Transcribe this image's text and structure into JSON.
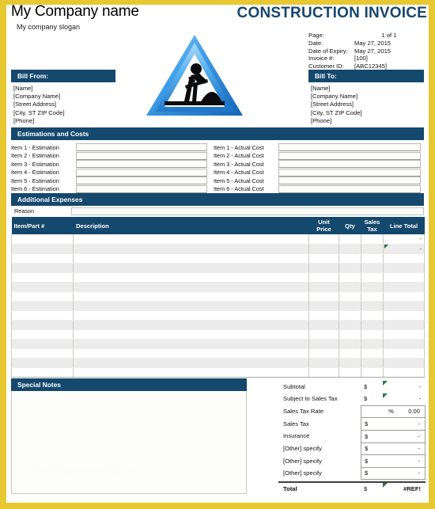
{
  "company": {
    "name": "My Company name",
    "slogan": "My company slogan"
  },
  "document": {
    "title": "CONSTRUCTION INVOICE",
    "logo_icon": "construction-men-at-work-sign-icon"
  },
  "meta": {
    "rows": [
      {
        "label": "Page:",
        "value": "1 of  1"
      },
      {
        "label": "Date:",
        "value": "May 27, 2015"
      },
      {
        "label": "Date of Expiry:",
        "value": "May 27, 2015"
      },
      {
        "label": "Invoice #:",
        "value": "[100]"
      },
      {
        "label": "Customer ID:",
        "value": "[ABC12345]"
      }
    ]
  },
  "bill_from": {
    "title": "Bill From:",
    "lines": [
      "[Name]",
      "[Company Name]",
      "[Street Address]",
      "[City, ST  ZIP Code]",
      "[Phone]"
    ]
  },
  "bill_to": {
    "title": "Bill To:",
    "lines": [
      "[Name]",
      "[Company Name]",
      "[Street Address]",
      "[City, ST  ZIP Code]",
      "[Phone]"
    ]
  },
  "estimations": {
    "title": "Estimations and Costs",
    "left_labels": [
      "Item 1 - Estimation",
      "Item 2 - Estimation",
      "Item 3 - Estimation",
      "Item 4 - Estimation",
      "Item 5 - Estimation",
      "Item 6 - Estimation"
    ],
    "left_values": [
      "",
      "",
      "",
      "",
      "",
      ""
    ],
    "right_labels": [
      "Item 1 - Actual Cost",
      "Item 2 - Actual Cost",
      "Item 3 - Actual Cost",
      "Item 4 - Actual Cost",
      "Item 5 - Actual Cost",
      "Item 6 - Actual Cost"
    ],
    "right_values": [
      "",
      "",
      "",
      "",
      "",
      ""
    ]
  },
  "additional_expenses": {
    "title": "Additional Expenses",
    "reason_label": "Reason",
    "reason_value": ""
  },
  "items_table": {
    "columns": [
      "Item/Part #",
      "Description",
      "Unit Price",
      "Qty",
      "Sales Tax",
      "Line Total"
    ],
    "rows": [
      {
        "item": "",
        "description": "",
        "unit_price": "",
        "qty": "",
        "sales_tax": "",
        "line_total": "-",
        "flag": false
      },
      {
        "item": "",
        "description": "",
        "unit_price": "",
        "qty": "",
        "sales_tax": "",
        "line_total": "-",
        "flag": true
      },
      {
        "item": "",
        "description": "",
        "unit_price": "",
        "qty": "",
        "sales_tax": "",
        "line_total": "",
        "flag": false
      },
      {
        "item": "",
        "description": "",
        "unit_price": "",
        "qty": "",
        "sales_tax": "",
        "line_total": "",
        "flag": false
      },
      {
        "item": "",
        "description": "",
        "unit_price": "",
        "qty": "",
        "sales_tax": "",
        "line_total": "",
        "flag": false
      },
      {
        "item": "",
        "description": "",
        "unit_price": "",
        "qty": "",
        "sales_tax": "",
        "line_total": "",
        "flag": false
      },
      {
        "item": "",
        "description": "",
        "unit_price": "",
        "qty": "",
        "sales_tax": "",
        "line_total": "",
        "flag": false
      },
      {
        "item": "",
        "description": "",
        "unit_price": "",
        "qty": "",
        "sales_tax": "",
        "line_total": "",
        "flag": false
      },
      {
        "item": "",
        "description": "",
        "unit_price": "",
        "qty": "",
        "sales_tax": "",
        "line_total": "",
        "flag": false
      },
      {
        "item": "",
        "description": "",
        "unit_price": "",
        "qty": "",
        "sales_tax": "",
        "line_total": "",
        "flag": false
      },
      {
        "item": "",
        "description": "",
        "unit_price": "",
        "qty": "",
        "sales_tax": "",
        "line_total": "",
        "flag": false
      },
      {
        "item": "",
        "description": "",
        "unit_price": "",
        "qty": "",
        "sales_tax": "",
        "line_total": "",
        "flag": false
      },
      {
        "item": "",
        "description": "",
        "unit_price": "",
        "qty": "",
        "sales_tax": "",
        "line_total": "",
        "flag": false
      },
      {
        "item": "",
        "description": "",
        "unit_price": "",
        "qty": "",
        "sales_tax": "",
        "line_total": "",
        "flag": false
      },
      {
        "item": "",
        "description": "",
        "unit_price": "",
        "qty": "",
        "sales_tax": "",
        "line_total": "",
        "flag": false
      }
    ]
  },
  "special_notes": {
    "title": "Special Notes",
    "body": "",
    "watermark": "www.thelayoutmakingdesign.com"
  },
  "totals": {
    "rows": [
      {
        "label": "Subtotal",
        "currency": "$",
        "amount": "-",
        "boxed": false,
        "flag": true,
        "percent": null
      },
      {
        "label": "Subject to Sales Tax",
        "currency": "$",
        "amount": "-",
        "boxed": false,
        "flag": true,
        "percent": null
      },
      {
        "label": "Sales Tax Rate",
        "currency": "",
        "amount": "0.00",
        "boxed": true,
        "flag": false,
        "percent": "%"
      },
      {
        "label": "Sales Tax",
        "currency": "$",
        "amount": "-",
        "boxed": true,
        "flag": false,
        "percent": null
      },
      {
        "label": "Insurance",
        "currency": "$",
        "amount": "-",
        "boxed": true,
        "flag": false,
        "percent": null
      },
      {
        "label": "[Other] specify",
        "currency": "$",
        "amount": "-",
        "boxed": true,
        "flag": false,
        "percent": null
      },
      {
        "label": "[Other] specify",
        "currency": "$",
        "amount": "-",
        "boxed": true,
        "flag": false,
        "percent": null
      },
      {
        "label": "[Other] specify",
        "currency": "$",
        "amount": "-",
        "boxed": true,
        "flag": false,
        "percent": null
      }
    ],
    "total": {
      "label": "Total",
      "currency": "$",
      "amount": "#REF!",
      "flag": true
    }
  },
  "colors": {
    "border_yellow": "#e8c832",
    "header_navy": "#15486d",
    "title_blue": "#16476e",
    "row_stripe": "#ececec",
    "flag_green": "#1f6b33"
  }
}
